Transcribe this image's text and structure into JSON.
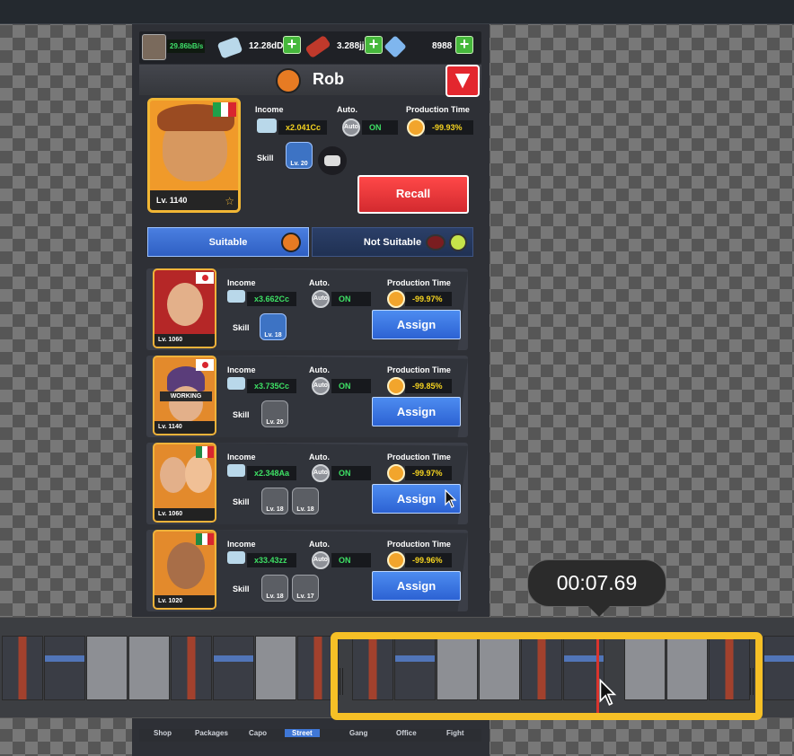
{
  "resources": {
    "rate": "29.86bB/s",
    "cash": "12.28dD",
    "dynamite": "3.288jj",
    "diamonds": "8988"
  },
  "header": {
    "title": "Rob"
  },
  "current_worker": {
    "level": "Lv. 1140",
    "income_label": "Income",
    "income_value": "x2.041Cc",
    "auto_label": "Auto.",
    "auto_status": "ON",
    "auto_icon_text": "Auto",
    "production_label": "Production Time",
    "production_value": "-99.93%",
    "skill_label": "Skill",
    "skill_level": "Lv. 20",
    "recall_label": "Recall"
  },
  "tabs": {
    "suitable": "Suitable",
    "not_suitable": "Not Suitable"
  },
  "candidates": [
    {
      "level": "Lv. 1060",
      "income": "x3.662Cc",
      "auto": "ON",
      "production": "-99.97%",
      "skills": [
        "Lv. 18"
      ],
      "assign": "Assign",
      "status": ""
    },
    {
      "level": "Lv. 1140",
      "income": "x3.735Cc",
      "auto": "ON",
      "production": "-99.85%",
      "skills": [
        "Lv. 20"
      ],
      "assign": "Assign",
      "status": "WORKING"
    },
    {
      "level": "Lv. 1060",
      "income": "x2.348Aa",
      "auto": "ON",
      "production": "-99.97%",
      "skills": [
        "Lv. 18",
        "Lv. 18"
      ],
      "assign": "Assign",
      "status": ""
    },
    {
      "level": "Lv. 1020",
      "income": "x33.43zz",
      "auto": "ON",
      "production": "-99.96%",
      "skills": [
        "Lv. 18",
        "Lv. 17"
      ],
      "assign": "Assign",
      "status": ""
    }
  ],
  "card_labels": {
    "income": "Income",
    "auto": "Auto.",
    "production": "Production Time",
    "skill": "Skill",
    "auto_icon": "Auto"
  },
  "bottom_nav": [
    "Shop",
    "Packages",
    "Capo",
    "Street",
    "Gang",
    "Office",
    "Fight"
  ],
  "timeline": {
    "time": "00:07.69"
  },
  "colors": {
    "accent_blue": "#3f77d6",
    "recall_red": "#e3272e",
    "selection_yellow": "#f6c026",
    "on_green": "#3ee065",
    "value_yellow": "#f5d320"
  },
  "icons": [
    "cash-icon",
    "dynamite-icon",
    "diamond-icon",
    "plus-icon",
    "down-arrow-icon",
    "clock-icon",
    "auto-icon",
    "skill-icon",
    "chat-icon",
    "hat-icon",
    "lightbulb-icon",
    "star-icon"
  ]
}
